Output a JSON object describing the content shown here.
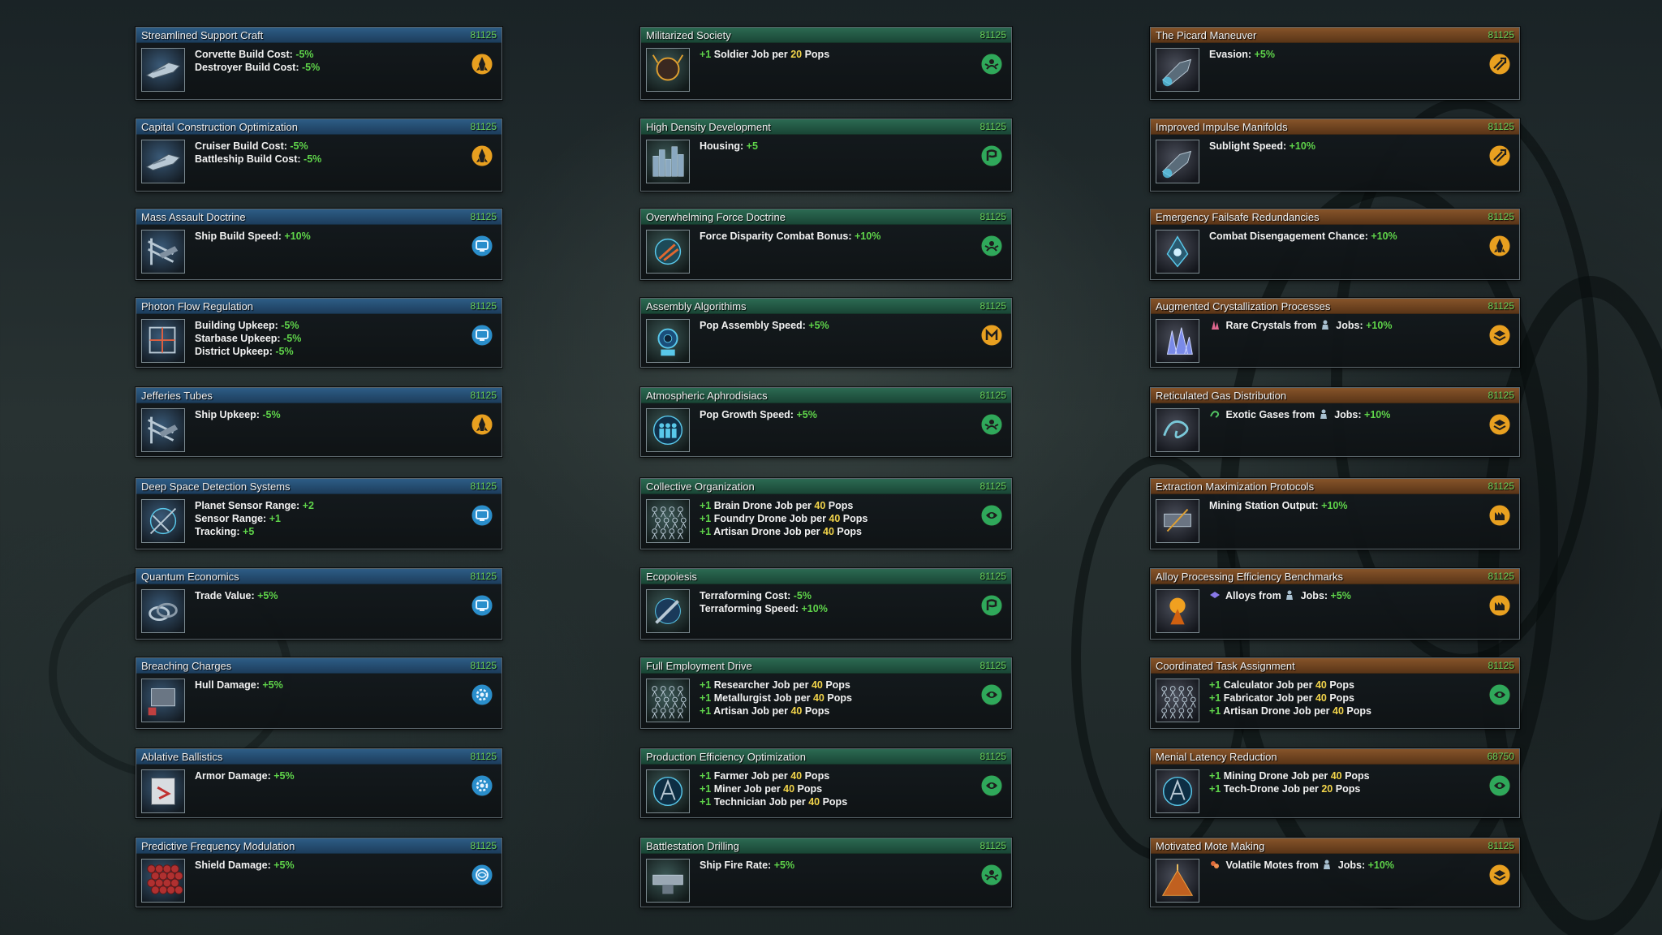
{
  "columns": [
    {
      "theme": "blue",
      "cards": [
        {
          "title": "Streamlined Support Craft",
          "cost": "81125",
          "thumb": "corvette-ship-icon",
          "cat": "orange-rocket",
          "effects": [
            [
              {
                "t": "Corvette Build Cost: "
              },
              {
                "t": "-5%",
                "c": "val"
              }
            ],
            [
              {
                "t": "Destroyer Build Cost: "
              },
              {
                "t": "-5%",
                "c": "val"
              }
            ]
          ]
        },
        {
          "title": "Capital Construction Optimization",
          "cost": "81125",
          "thumb": "cruiser-ship-icon",
          "cat": "orange-rocket",
          "effects": [
            [
              {
                "t": "Cruiser Build Cost: "
              },
              {
                "t": "-5%",
                "c": "val"
              }
            ],
            [
              {
                "t": "Battleship Build Cost: "
              },
              {
                "t": "-5%",
                "c": "val"
              }
            ]
          ]
        },
        {
          "title": "Mass Assault Doctrine",
          "cost": "81125",
          "thumb": "shipyard-icon",
          "cat": "blue-computer",
          "effects": [
            [
              {
                "t": "Ship Build Speed: "
              },
              {
                "t": "+10%",
                "c": "val"
              }
            ]
          ]
        },
        {
          "title": "Photon Flow Regulation",
          "cost": "81125",
          "thumb": "energy-grid-icon",
          "cat": "blue-computer",
          "effects": [
            [
              {
                "t": "Building Upkeep: "
              },
              {
                "t": "-5%",
                "c": "val"
              }
            ],
            [
              {
                "t": "Starbase Upkeep: "
              },
              {
                "t": "-5%",
                "c": "val"
              }
            ],
            [
              {
                "t": "District Upkeep: "
              },
              {
                "t": "-5%",
                "c": "val"
              }
            ]
          ]
        },
        {
          "title": "Jefferies Tubes",
          "cost": "81125",
          "thumb": "ship-maintenance-icon",
          "cat": "orange-rocket",
          "effects": [
            [
              {
                "t": "Ship Upkeep: "
              },
              {
                "t": "-5%",
                "c": "val"
              }
            ]
          ]
        },
        {
          "title": "Deep Space Detection Systems",
          "cost": "81125",
          "thumb": "sensor-array-icon",
          "cat": "blue-computer",
          "effects": [
            [
              {
                "t": "Planet Sensor Range: "
              },
              {
                "t": "+2",
                "c": "val"
              }
            ],
            [
              {
                "t": "Sensor Range: "
              },
              {
                "t": "+1",
                "c": "val"
              }
            ],
            [
              {
                "t": "Tracking: "
              },
              {
                "t": "+5",
                "c": "val"
              }
            ]
          ]
        },
        {
          "title": "Quantum Economics",
          "cost": "81125",
          "thumb": "trade-rings-icon",
          "cat": "blue-computer",
          "effects": [
            [
              {
                "t": "Trade Value: "
              },
              {
                "t": "+5%",
                "c": "val"
              }
            ]
          ]
        },
        {
          "title": "Breaching Charges",
          "cost": "81125",
          "thumb": "explosive-charge-icon",
          "cat": "blue-gear",
          "effects": [
            [
              {
                "t": "Hull Damage: "
              },
              {
                "t": "+5%",
                "c": "val"
              }
            ]
          ]
        },
        {
          "title": "Ablative Ballistics",
          "cost": "81125",
          "thumb": "armor-plating-icon",
          "cat": "blue-gear",
          "effects": [
            [
              {
                "t": "Armor Damage: "
              },
              {
                "t": "+5%",
                "c": "val"
              }
            ]
          ]
        },
        {
          "title": "Predictive Frequency Modulation",
          "cost": "81125",
          "thumb": "shield-hex-icon",
          "cat": "blue-swirl",
          "effects": [
            [
              {
                "t": "Shield Damage: "
              },
              {
                "t": "+5%",
                "c": "val"
              }
            ]
          ]
        }
      ]
    },
    {
      "theme": "green",
      "cards": [
        {
          "title": "Militarized Society",
          "cost": "81125",
          "thumb": "soldier-alien-icon",
          "cat": "green-unity",
          "effects": [
            [
              {
                "t": "+1",
                "c": "val"
              },
              {
                "t": " Soldier Job per "
              },
              {
                "t": "20",
                "c": "num"
              },
              {
                "t": " Pops"
              }
            ]
          ]
        },
        {
          "title": "High Density Development",
          "cost": "81125",
          "thumb": "city-skyline-icon",
          "cat": "green-society",
          "effects": [
            [
              {
                "t": "Housing: "
              },
              {
                "t": "+5",
                "c": "val"
              }
            ]
          ]
        },
        {
          "title": "Overwhelming Force Doctrine",
          "cost": "81125",
          "thumb": "fleet-strike-icon",
          "cat": "green-unity",
          "effects": [
            [
              {
                "t": "Force Disparity Combat Bonus: "
              },
              {
                "t": "+10%",
                "c": "val"
              }
            ]
          ]
        },
        {
          "title": "Assembly Algorithims",
          "cost": "81125",
          "thumb": "robot-assembly-icon",
          "cat": "orange-engineering",
          "effects": [
            [
              {
                "t": "Pop Assembly Speed: "
              },
              {
                "t": "+5%",
                "c": "val"
              }
            ]
          ]
        },
        {
          "title": "Atmospheric Aphrodisiacs",
          "cost": "81125",
          "thumb": "population-growth-icon",
          "cat": "green-unity",
          "effects": [
            [
              {
                "t": "Pop Growth Speed: "
              },
              {
                "t": "+5%",
                "c": "val"
              }
            ]
          ]
        },
        {
          "title": "Collective Organization",
          "cost": "81125",
          "thumb": "crowd-network-icon",
          "cat": "green-biology",
          "effects": [
            [
              {
                "t": "+1",
                "c": "val"
              },
              {
                "t": " Brain Drone Job per "
              },
              {
                "t": "40",
                "c": "num"
              },
              {
                "t": " Pops"
              }
            ],
            [
              {
                "t": "+1",
                "c": "val"
              },
              {
                "t": " Foundry Drone Job per "
              },
              {
                "t": "40",
                "c": "num"
              },
              {
                "t": " Pops"
              }
            ],
            [
              {
                "t": "+1",
                "c": "val"
              },
              {
                "t": " Artisan Drone Job per "
              },
              {
                "t": "40",
                "c": "num"
              },
              {
                "t": " Pops"
              }
            ]
          ]
        },
        {
          "title": "Ecopoiesis",
          "cost": "81125",
          "thumb": "terraforming-icon",
          "cat": "green-society",
          "effects": [
            [
              {
                "t": "Terraforming Cost: "
              },
              {
                "t": "-5%",
                "c": "val"
              }
            ],
            [
              {
                "t": "Terraforming Speed: "
              },
              {
                "t": "+10%",
                "c": "val"
              }
            ]
          ]
        },
        {
          "title": "Full Employment Drive",
          "cost": "81125",
          "thumb": "crowd-network-icon",
          "cat": "green-biology",
          "effects": [
            [
              {
                "t": "+1",
                "c": "val"
              },
              {
                "t": " Researcher Job per "
              },
              {
                "t": "40",
                "c": "num"
              },
              {
                "t": " Pops"
              }
            ],
            [
              {
                "t": "+1",
                "c": "val"
              },
              {
                "t": " Metallurgist Job per "
              },
              {
                "t": "40",
                "c": "num"
              },
              {
                "t": " Pops"
              }
            ],
            [
              {
                "t": "+1",
                "c": "val"
              },
              {
                "t": " Artisan Job per "
              },
              {
                "t": "40",
                "c": "num"
              },
              {
                "t": " Pops"
              }
            ]
          ]
        },
        {
          "title": "Production Efficiency Optimization",
          "cost": "81125",
          "thumb": "worker-efficiency-icon",
          "cat": "green-biology",
          "effects": [
            [
              {
                "t": "+1",
                "c": "val"
              },
              {
                "t": " Farmer Job per "
              },
              {
                "t": "40",
                "c": "num"
              },
              {
                "t": " Pops"
              }
            ],
            [
              {
                "t": "+1",
                "c": "val"
              },
              {
                "t": " Miner Job per "
              },
              {
                "t": "40",
                "c": "num"
              },
              {
                "t": " Pops"
              }
            ],
            [
              {
                "t": "+1",
                "c": "val"
              },
              {
                "t": " Technician Job per "
              },
              {
                "t": "40",
                "c": "num"
              },
              {
                "t": " Pops"
              }
            ]
          ]
        },
        {
          "title": "Battlestation Drilling",
          "cost": "81125",
          "thumb": "battlestation-icon",
          "cat": "green-unity",
          "effects": [
            [
              {
                "t": "Ship Fire Rate: "
              },
              {
                "t": "+5%",
                "c": "val"
              }
            ]
          ]
        }
      ]
    },
    {
      "theme": "orange",
      "cards": [
        {
          "title": "The Picard Maneuver",
          "cost": "81125",
          "thumb": "ship-evasion-icon",
          "cat": "orange-propulsion",
          "effects": [
            [
              {
                "t": "Evasion: "
              },
              {
                "t": "+5%",
                "c": "val"
              }
            ]
          ]
        },
        {
          "title": "Improved Impulse Manifolds",
          "cost": "81125",
          "thumb": "thruster-icon",
          "cat": "orange-propulsion",
          "effects": [
            [
              {
                "t": "Sublight Speed: "
              },
              {
                "t": "+10%",
                "c": "val"
              }
            ]
          ]
        },
        {
          "title": "Emergency Failsafe Redundancies",
          "cost": "81125",
          "thumb": "escape-pod-icon",
          "cat": "orange-rocket",
          "effects": [
            [
              {
                "t": "Combat Disengagement Chance: "
              },
              {
                "t": "+10%",
                "c": "val"
              }
            ]
          ]
        },
        {
          "title": "Augmented Crystallization Processes",
          "cost": "81125",
          "thumb": "crystal-icon",
          "cat": "orange-materials",
          "effects": [
            [
              {
                "t": "RARE",
                "c": "icon-crystal"
              },
              {
                "t": " Rare Crystals from "
              },
              {
                "t": "POP",
                "c": "icon-pop"
              },
              {
                "t": " Jobs: "
              },
              {
                "t": "+10%",
                "c": "val"
              }
            ]
          ]
        },
        {
          "title": "Reticulated Gas Distribution",
          "cost": "81125",
          "thumb": "gas-swirl-icon",
          "cat": "orange-materials",
          "effects": [
            [
              {
                "t": "GAS",
                "c": "icon-gas"
              },
              {
                "t": " Exotic Gases from "
              },
              {
                "t": "POP",
                "c": "icon-pop"
              },
              {
                "t": " Jobs: "
              },
              {
                "t": "+10%",
                "c": "val"
              }
            ]
          ]
        },
        {
          "title": "Extraction Maximization Protocols",
          "cost": "81125",
          "thumb": "mining-station-icon",
          "cat": "orange-industry",
          "effects": [
            [
              {
                "t": "Mining Station Output: "
              },
              {
                "t": "+10%",
                "c": "val"
              }
            ]
          ]
        },
        {
          "title": "Alloy Processing Efficiency Benchmarks",
          "cost": "81125",
          "thumb": "molten-alloy-icon",
          "cat": "orange-industry",
          "effects": [
            [
              {
                "t": "ALLOY",
                "c": "icon-alloy"
              },
              {
                "t": " Alloys from "
              },
              {
                "t": "POP",
                "c": "icon-pop"
              },
              {
                "t": " Jobs: "
              },
              {
                "t": "+5%",
                "c": "val"
              }
            ]
          ]
        },
        {
          "title": "Coordinated Task Assignment",
          "cost": "81125",
          "thumb": "crowd-network-icon",
          "cat": "green-biology",
          "effects": [
            [
              {
                "t": "+1",
                "c": "val"
              },
              {
                "t": " Calculator Job per "
              },
              {
                "t": "40",
                "c": "num"
              },
              {
                "t": " Pops"
              }
            ],
            [
              {
                "t": "+1",
                "c": "val"
              },
              {
                "t": " Fabricator Job per "
              },
              {
                "t": "40",
                "c": "num"
              },
              {
                "t": " Pops"
              }
            ],
            [
              {
                "t": "+1",
                "c": "val"
              },
              {
                "t": " Artisan Drone Job per "
              },
              {
                "t": "40",
                "c": "num"
              },
              {
                "t": " Pops"
              }
            ]
          ]
        },
        {
          "title": "Menial Latency Reduction",
          "cost": "68750",
          "thumb": "worker-efficiency-icon",
          "cat": "green-biology",
          "effects": [
            [
              {
                "t": "+1",
                "c": "val"
              },
              {
                "t": " Mining Drone Job per "
              },
              {
                "t": "40",
                "c": "num"
              },
              {
                "t": " Pops"
              }
            ],
            [
              {
                "t": "+1",
                "c": "val"
              },
              {
                "t": " Tech-Drone Job per "
              },
              {
                "t": "20",
                "c": "num"
              },
              {
                "t": " Pops"
              }
            ]
          ]
        },
        {
          "title": "Motivated Mote Making",
          "cost": "81125",
          "thumb": "volatile-motes-icon",
          "cat": "orange-materials",
          "effects": [
            [
              {
                "t": "MOTE",
                "c": "icon-mote"
              },
              {
                "t": " Volatile Motes from "
              },
              {
                "t": "POP",
                "c": "icon-pop"
              },
              {
                "t": " Jobs: "
              },
              {
                "t": "+10%",
                "c": "val"
              }
            ]
          ]
        }
      ]
    }
  ],
  "colors": {
    "cost": "#68d05a",
    "value": "#5fd44a",
    "number": "#f2d44a",
    "cat_orange": "#e8a020",
    "cat_blue": "#2a8ecb",
    "cat_green": "#2fa85a"
  }
}
